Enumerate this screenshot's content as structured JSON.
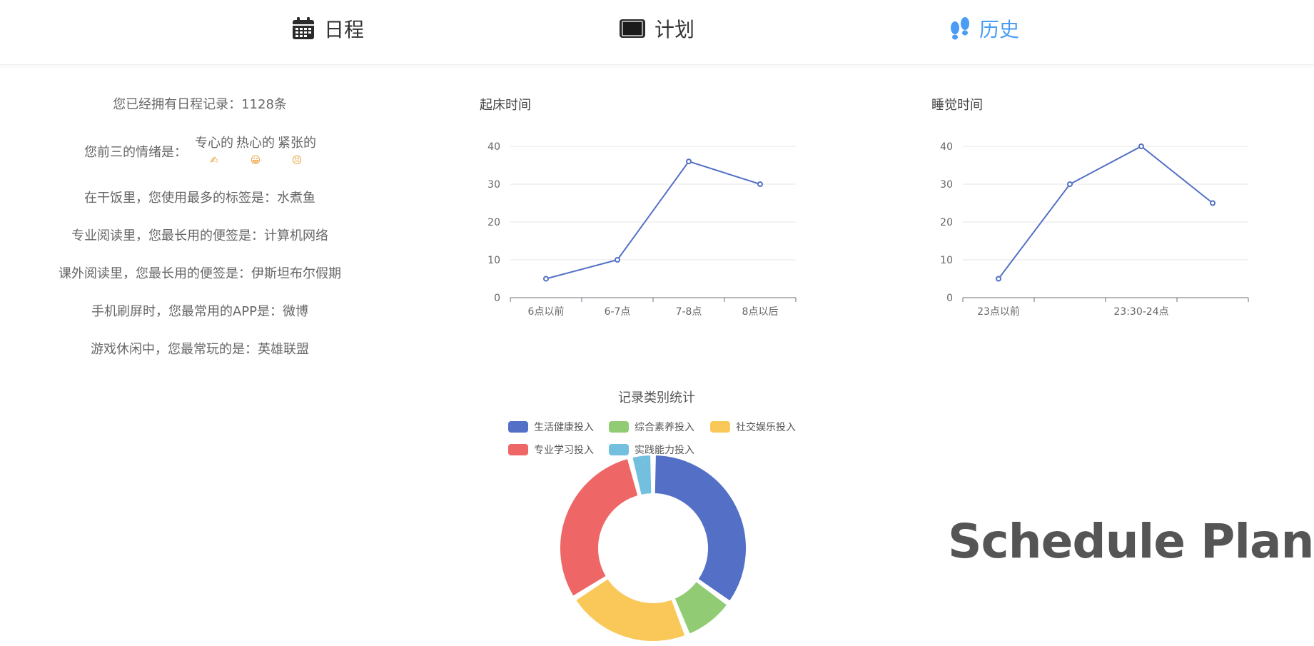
{
  "nav": {
    "tabs": [
      {
        "label": "日程",
        "icon": "calendar-icon"
      },
      {
        "label": "计划",
        "icon": "tablet-icon"
      },
      {
        "label": "历史",
        "icon": "footprints-icon",
        "active": true
      }
    ],
    "active_color": "#4a9cf5"
  },
  "stats": {
    "records": "您已经拥有日程记录：1128条",
    "mood_label": "您前三的情绪是：",
    "moods": [
      {
        "word": "专心的",
        "emoji": "✍"
      },
      {
        "word": "热心的",
        "emoji": "😀"
      },
      {
        "word": "紧张的",
        "emoji": "😣"
      }
    ],
    "lines": [
      "在干饭里，您使用最多的标签是：水煮鱼",
      "专业阅读里，您最长用的便签是：计算机网络",
      "课外阅读里，您最长用的便签是：伊斯坦布尔假期",
      "手机刷屏时，您最常用的APP是：微博",
      "游戏休闲中，您最常玩的是：英雄联盟"
    ]
  },
  "brand": "Schedule Plan",
  "chart_data": [
    {
      "type": "line",
      "title": "起床时间",
      "categories": [
        "6点以前",
        "6-7点",
        "7-8点",
        "8点以后"
      ],
      "values": [
        5,
        10,
        36,
        30
      ],
      "ylim": [
        0,
        40
      ],
      "yticks": [
        0,
        10,
        20,
        30,
        40
      ],
      "grid": true,
      "color": "#5470c6"
    },
    {
      "type": "line",
      "title": "睡觉时间",
      "categories": [
        "23点以前",
        "",
        "23:30-24点",
        ""
      ],
      "values": [
        5,
        30,
        40,
        25
      ],
      "ylim": [
        0,
        40
      ],
      "yticks": [
        0,
        10,
        20,
        30,
        40
      ],
      "grid": true,
      "color": "#5470c6"
    },
    {
      "type": "pie",
      "title": "记录类别统计",
      "legend_position": "top",
      "slices": [
        {
          "name": "生活健康投入",
          "value": 35,
          "color": "#5470c6"
        },
        {
          "name": "综合素养投入",
          "value": 9,
          "color": "#91cc75"
        },
        {
          "name": "社交娱乐投入",
          "value": 22,
          "color": "#fac858"
        },
        {
          "name": "专业学习投入",
          "value": 30,
          "color": "#ee6666"
        },
        {
          "name": "实践能力投入",
          "value": 4,
          "color": "#73c0de"
        }
      ]
    }
  ]
}
